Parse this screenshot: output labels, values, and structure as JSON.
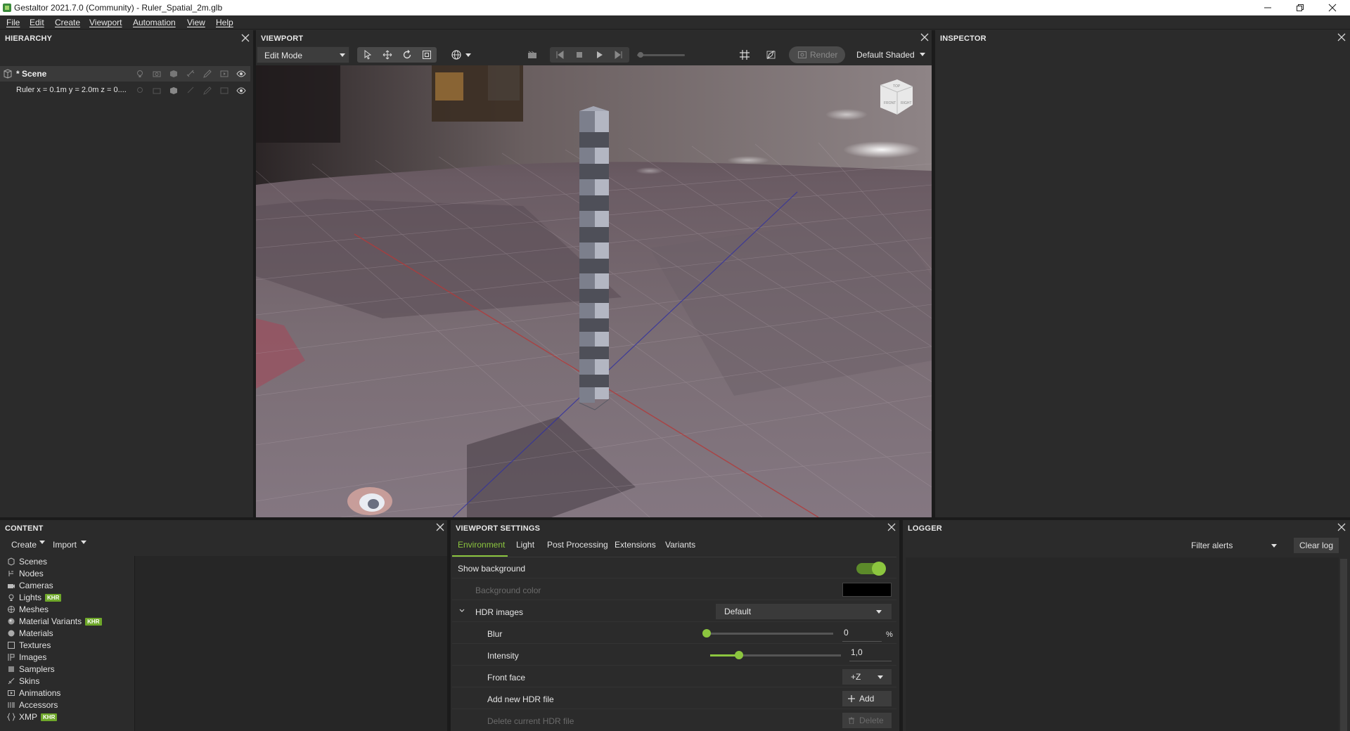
{
  "window": {
    "title": "Gestaltor 2021.7.0 (Community) - Ruler_Spatial_2m.glb"
  },
  "menu": [
    "File",
    "Edit",
    "Create",
    "Viewport",
    "Automation",
    "View",
    "Help"
  ],
  "hierarchy": {
    "header": "HIERARCHY",
    "scene_label": "* Scene",
    "node_label": "Ruler x = 0.1m y = 2.0m z = 0...."
  },
  "viewport": {
    "header": "VIEWPORT",
    "mode": "Edit Mode",
    "render_label": "Render",
    "shading": "Default Shaded",
    "cube_labels": [
      "TOP",
      "FRONT",
      "RIGHT"
    ]
  },
  "inspector": {
    "header": "INSPECTOR"
  },
  "content": {
    "header": "CONTENT",
    "create_label": "Create",
    "import_label": "Import",
    "items": [
      {
        "label": "Scenes",
        "khr": ""
      },
      {
        "label": "Nodes",
        "khr": ""
      },
      {
        "label": "Cameras",
        "khr": ""
      },
      {
        "label": "Lights",
        "khr": "KHR"
      },
      {
        "label": "Meshes",
        "khr": ""
      },
      {
        "label": "Material Variants",
        "khr": "KHR"
      },
      {
        "label": "Materials",
        "khr": ""
      },
      {
        "label": "Textures",
        "khr": ""
      },
      {
        "label": "Images",
        "khr": ""
      },
      {
        "label": "Samplers",
        "khr": ""
      },
      {
        "label": "Skins",
        "khr": ""
      },
      {
        "label": "Animations",
        "khr": ""
      },
      {
        "label": "Accessors",
        "khr": ""
      },
      {
        "label": "XMP",
        "khr": "KHR"
      }
    ]
  },
  "viewport_settings": {
    "header": "VIEWPORT SETTINGS",
    "tabs": [
      "Environment",
      "Light",
      "Post Processing",
      "Extensions",
      "Variants"
    ],
    "active_tab": "Environment",
    "show_background": "Show background",
    "show_background_on": true,
    "background_color_label": "Background color",
    "background_color": "#000000",
    "hdr_label": "HDR images",
    "hdr_value": "Default",
    "blur_label": "Blur",
    "blur_value": "0",
    "blur_unit": "%",
    "blur_fraction": 0.0,
    "intensity_label": "Intensity",
    "intensity_value": "1,0",
    "intensity_fraction": 0.22,
    "front_face_label": "Front face",
    "front_face_value": "+Z",
    "add_hdr_label": "Add new HDR file",
    "add_button": "Add",
    "delete_hdr_label": "Delete current HDR file",
    "delete_button": "Delete"
  },
  "logger": {
    "header": "LOGGER",
    "filter_label": "Filter alerts",
    "clear_label": "Clear log"
  },
  "colors": {
    "accent": "#8cc63f",
    "panel": "#2b2b2b",
    "khr_badge": "#6fa82a"
  }
}
